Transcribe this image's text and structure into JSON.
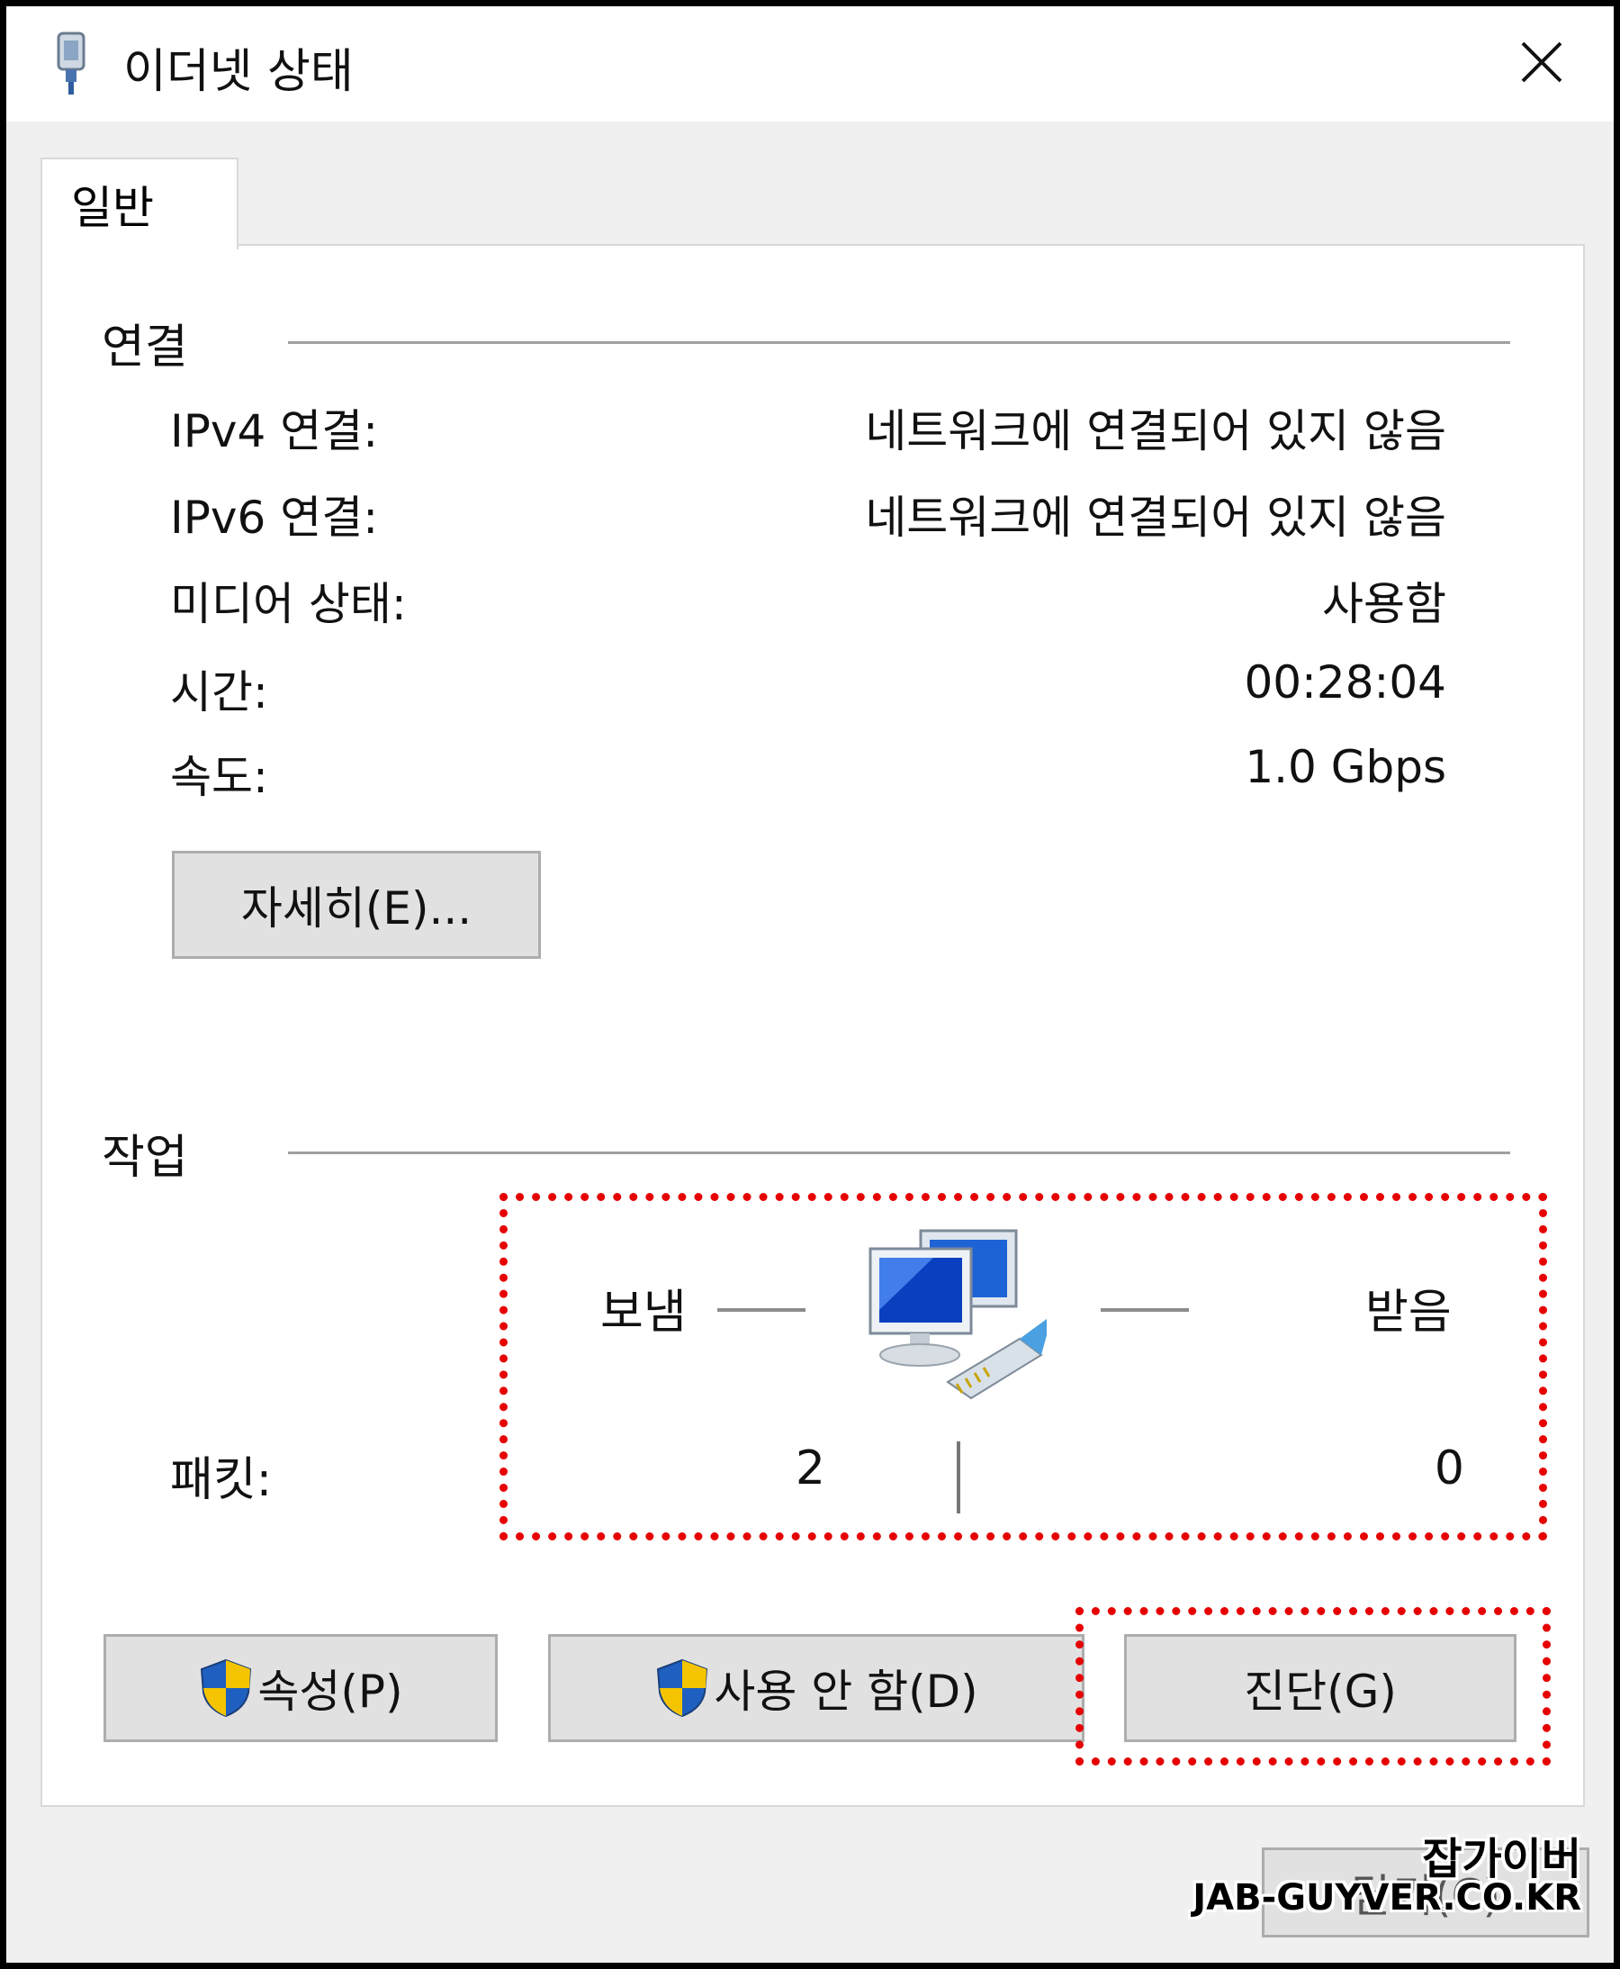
{
  "window": {
    "title": "이더넷 상태",
    "icon": "ethernet-adapter-icon",
    "close_icon": "close-icon"
  },
  "tabs": [
    {
      "label": "일반",
      "selected": true
    }
  ],
  "connection": {
    "section_label": "연결",
    "rows": [
      {
        "label": "IPv4 연결:",
        "value": "네트워크에 연결되어 있지 않음"
      },
      {
        "label": "IPv6 연결:",
        "value": "네트워크에 연결되어 있지 않음"
      },
      {
        "label": "미디어 상태:",
        "value": "사용함"
      },
      {
        "label": "시간:",
        "value": "00:28:04"
      },
      {
        "label": "속도:",
        "value": "1.0 Gbps"
      }
    ],
    "details_button": "자세히(E)..."
  },
  "activity": {
    "section_label": "작업",
    "sent_label": "보냄",
    "received_label": "받음",
    "packets_label": "패킷:",
    "packets_sent": "2",
    "packets_received": "0",
    "icon": "network-computers-icon"
  },
  "buttons": {
    "properties": "속성(P)",
    "disable": "사용 안 함(D)",
    "diagnose": "진단(G)",
    "close": "닫기(C)"
  },
  "watermark": {
    "line1": "잡가이버",
    "line2": "JAB-GUYVER.CO.KR"
  },
  "colors": {
    "highlight": "#e60000",
    "button_face": "#e1e1e1",
    "shield_blue": "#1f5fbf",
    "shield_yellow": "#f5c400"
  }
}
